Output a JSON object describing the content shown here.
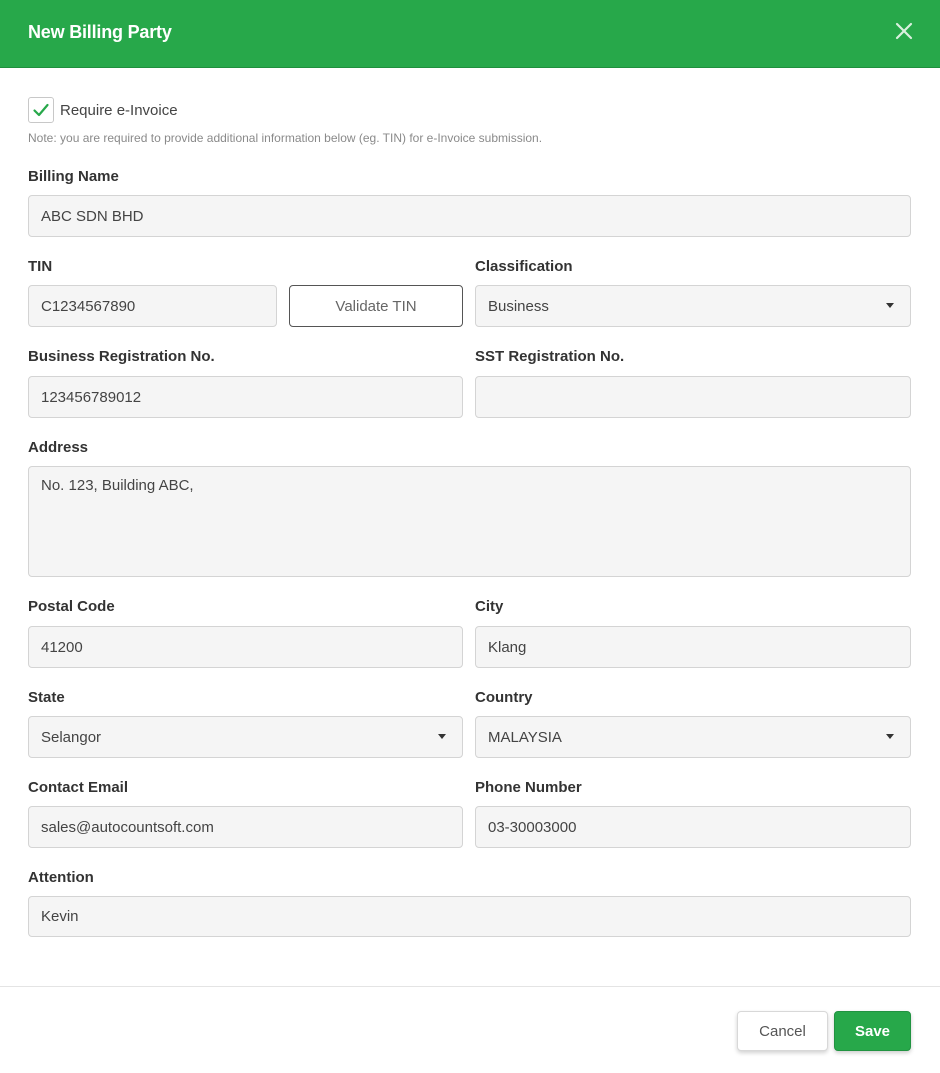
{
  "dialog": {
    "title": "New Billing Party"
  },
  "einvoice": {
    "checkbox_label": "Require e-Invoice",
    "checked": true,
    "note": "Note: you are required to provide additional information below (eg. TIN) for e-Invoice submission."
  },
  "fields": {
    "billing_name": {
      "label": "Billing Name",
      "value": "ABC SDN BHD"
    },
    "tin": {
      "label": "TIN",
      "value": "C1234567890"
    },
    "validate_tin": "Validate TIN",
    "classification": {
      "label": "Classification",
      "value": "Business"
    },
    "business_reg": {
      "label": "Business Registration No.",
      "value": "123456789012"
    },
    "sst_reg": {
      "label": "SST Registration No.",
      "value": ""
    },
    "address": {
      "label": "Address",
      "value": "No. 123, Building ABC,"
    },
    "postal_code": {
      "label": "Postal Code",
      "value": "41200"
    },
    "city": {
      "label": "City",
      "value": "Klang"
    },
    "state": {
      "label": "State",
      "value": "Selangor"
    },
    "country": {
      "label": "Country",
      "value": "MALAYSIA"
    },
    "email": {
      "label": "Contact Email",
      "value": "sales@autocountsoft.com"
    },
    "phone": {
      "label": "Phone Number",
      "value": "03-30003000"
    },
    "attention": {
      "label": "Attention",
      "value": "Kevin"
    }
  },
  "footer": {
    "cancel_label": "Cancel",
    "save_label": "Save"
  },
  "colors": {
    "brand": "#27a84a",
    "check": "#27a84a"
  },
  "icons": {
    "close": "close-icon",
    "check": "check-icon",
    "dropdown": "chevron-down-icon"
  }
}
